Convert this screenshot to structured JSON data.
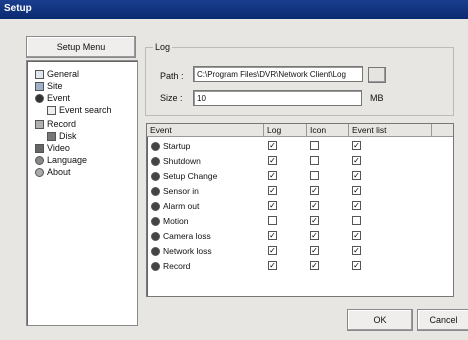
{
  "window": {
    "title": "Setup"
  },
  "menu": {
    "header": "Setup Menu",
    "items": [
      {
        "label": "General",
        "icon": "general-icon"
      },
      {
        "label": "Site",
        "icon": "site-icon"
      },
      {
        "label": "Event",
        "icon": "event-icon"
      },
      {
        "label": "Event search",
        "icon": "event-search-icon"
      },
      {
        "label": "Record",
        "icon": "record-icon"
      },
      {
        "label": "Disk",
        "icon": "disk-icon"
      },
      {
        "label": "Video",
        "icon": "video-icon"
      },
      {
        "label": "Language",
        "icon": "language-icon"
      },
      {
        "label": "About",
        "icon": "about-icon"
      }
    ]
  },
  "log": {
    "group_label": "Log",
    "path_label": "Path :",
    "path_value": "C:\\Program Files\\DVR\\Network Client\\Log",
    "size_label": "Size :",
    "size_value": "10",
    "size_unit": "MB"
  },
  "table": {
    "columns": [
      "Event",
      "Log",
      "Icon",
      "Event list"
    ],
    "rows": [
      {
        "event": "Startup",
        "icon": "startup-icon",
        "log": true,
        "icon_col": false,
        "event_list": true
      },
      {
        "event": "Shutdown",
        "icon": "shutdown-icon",
        "log": true,
        "icon_col": false,
        "event_list": true
      },
      {
        "event": "Setup Change",
        "icon": "setup-change-icon",
        "log": true,
        "icon_col": false,
        "event_list": true
      },
      {
        "event": "Sensor in",
        "icon": "sensor-in-icon",
        "log": true,
        "icon_col": true,
        "event_list": true
      },
      {
        "event": "Alarm out",
        "icon": "alarm-out-icon",
        "log": true,
        "icon_col": true,
        "event_list": true
      },
      {
        "event": "Motion",
        "icon": "motion-icon",
        "log": false,
        "icon_col": true,
        "event_list": false
      },
      {
        "event": "Camera loss",
        "icon": "camera-loss-icon",
        "log": true,
        "icon_col": true,
        "event_list": true
      },
      {
        "event": "Network loss",
        "icon": "network-loss-icon",
        "log": true,
        "icon_col": true,
        "event_list": true
      },
      {
        "event": "Record",
        "icon": "record-event-icon",
        "log": true,
        "icon_col": true,
        "event_list": true
      }
    ]
  },
  "buttons": {
    "ok": "OK",
    "cancel": "Cancel"
  }
}
